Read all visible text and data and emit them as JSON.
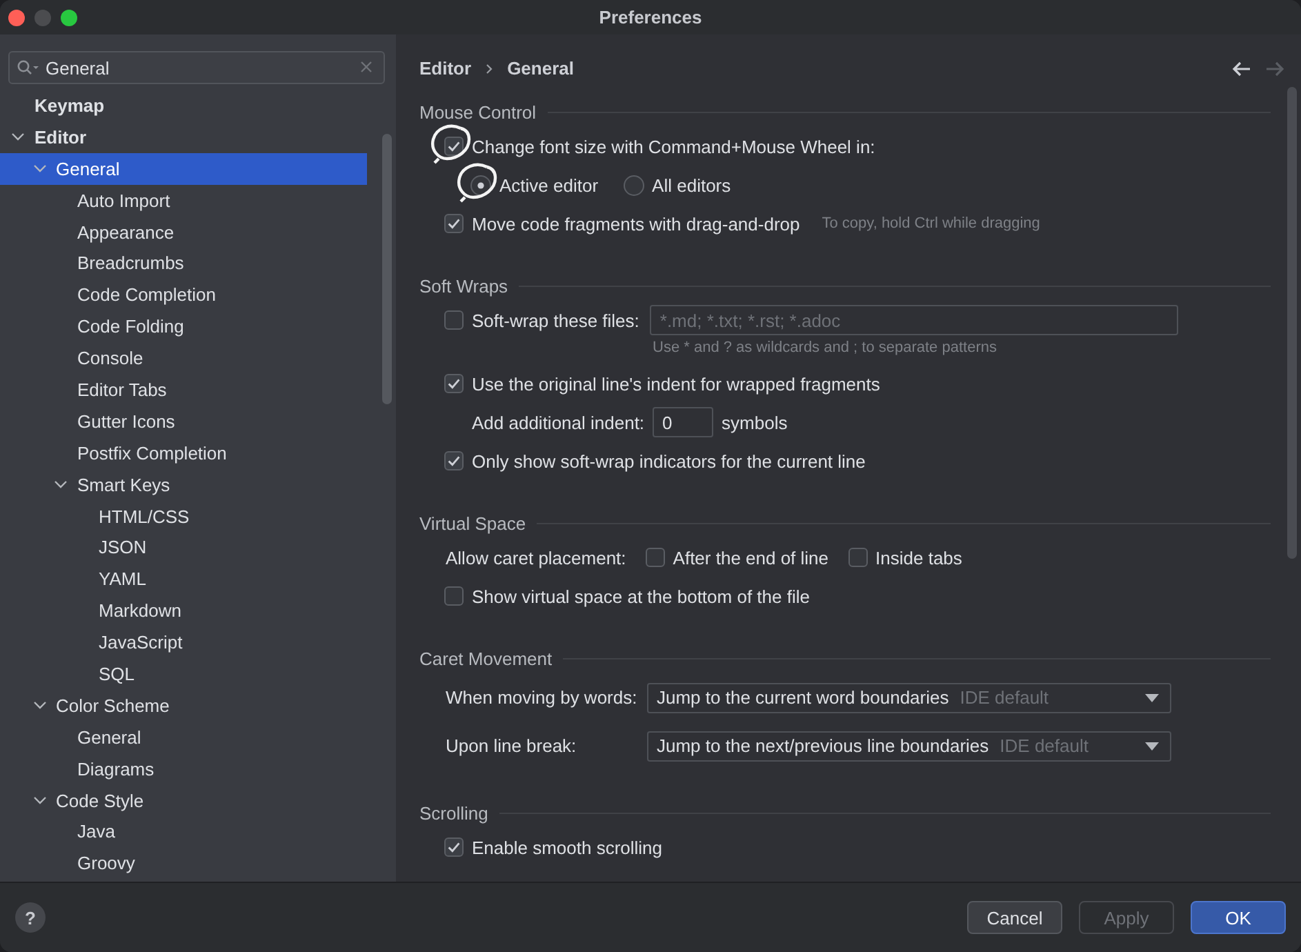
{
  "window": {
    "title": "Preferences"
  },
  "search": {
    "value": "General"
  },
  "sidebar": {
    "items": [
      {
        "label": "Keymap",
        "selected": false
      },
      {
        "label": "Editor",
        "selected": false,
        "expanded": true,
        "children": [
          {
            "label": "General",
            "selected": true,
            "expanded": true,
            "children": [
              {
                "label": "Auto Import",
                "selected": false
              },
              {
                "label": "Appearance",
                "selected": false
              },
              {
                "label": "Breadcrumbs",
                "selected": false
              },
              {
                "label": "Code Completion",
                "selected": false
              },
              {
                "label": "Code Folding",
                "selected": false
              },
              {
                "label": "Console",
                "selected": false
              },
              {
                "label": "Editor Tabs",
                "selected": false
              },
              {
                "label": "Gutter Icons",
                "selected": false
              },
              {
                "label": "Postfix Completion",
                "selected": false
              },
              {
                "label": "Smart Keys",
                "selected": false,
                "expanded": true,
                "children": [
                  {
                    "label": "HTML/CSS",
                    "selected": false
                  },
                  {
                    "label": "JSON",
                    "selected": false
                  },
                  {
                    "label": "YAML",
                    "selected": false
                  },
                  {
                    "label": "Markdown",
                    "selected": false
                  },
                  {
                    "label": "JavaScript",
                    "selected": false
                  },
                  {
                    "label": "SQL",
                    "selected": false
                  }
                ]
              }
            ]
          },
          {
            "label": "Color Scheme",
            "selected": false,
            "expanded": true,
            "children": [
              {
                "label": "General",
                "selected": false
              },
              {
                "label": "Diagrams",
                "selected": false
              }
            ]
          },
          {
            "label": "Code Style",
            "selected": false,
            "expanded": true,
            "children": [
              {
                "label": "Java",
                "selected": false
              },
              {
                "label": "Groovy",
                "selected": false
              }
            ]
          }
        ]
      }
    ]
  },
  "breadcrumb": [
    "Editor",
    "General"
  ],
  "navigation": {
    "back_disabled": false,
    "forward_disabled": true
  },
  "sections": [
    {
      "title": "Mouse Control",
      "rows": [
        {
          "kind": "checkbox",
          "label": "Change font size with Command+Mouse Wheel in:",
          "checked": true,
          "annotated": true
        },
        {
          "kind": "radios",
          "options": [
            {
              "label": "Active editor",
              "selected": true,
              "annotated": true
            },
            {
              "label": "All editors",
              "selected": false
            }
          ]
        },
        {
          "kind": "checkbox",
          "label": "Move code fragments with drag-and-drop",
          "checked": true,
          "note": "To copy, hold Ctrl while dragging"
        }
      ]
    },
    {
      "title": "Soft Wraps",
      "rows": [
        {
          "kind": "checkfield",
          "label": "Soft-wrap these files:",
          "checked": false,
          "placeholder": "*.md; *.txt; *.rst; *.adoc",
          "hint": "Use * and ? as wildcards and ; to separate patterns"
        },
        {
          "kind": "checkbox",
          "label": "Use the original line's indent for wrapped fragments",
          "checked": true
        },
        {
          "kind": "number",
          "label": "Add additional indent:",
          "value": "0",
          "unit": "symbols"
        },
        {
          "kind": "checkbox",
          "label": "Only show soft-wrap indicators for the current line",
          "checked": true
        }
      ]
    },
    {
      "title": "Virtual Space",
      "rows": [
        {
          "kind": "checkgroup",
          "label": "Allow caret placement:",
          "options": [
            {
              "label": "After the end of line",
              "checked": false
            },
            {
              "label": "Inside tabs",
              "checked": false
            }
          ]
        },
        {
          "kind": "checkbox",
          "label": "Show virtual space at the bottom of the file",
          "checked": false
        }
      ]
    },
    {
      "title": "Caret Movement",
      "rows": [
        {
          "kind": "select",
          "label": "When moving by words:",
          "value": "Jump to the current word boundaries",
          "suffix": "IDE default"
        },
        {
          "kind": "select",
          "label": "Upon line break:",
          "value": "Jump to the next/previous line boundaries",
          "suffix": "IDE default"
        }
      ]
    },
    {
      "title": "Scrolling",
      "rows": [
        {
          "kind": "checkbox",
          "label": "Enable smooth scrolling",
          "checked": true
        }
      ]
    }
  ],
  "buttons": [
    {
      "label": "Cancel",
      "disabled": false,
      "default": false
    },
    {
      "label": "Apply",
      "disabled": true,
      "default": false
    },
    {
      "label": "OK",
      "disabled": false,
      "default": true
    }
  ],
  "help": {
    "label": "?"
  }
}
